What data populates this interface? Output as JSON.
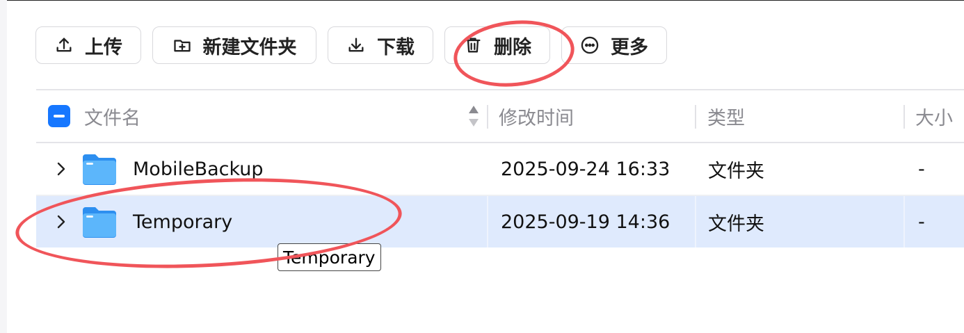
{
  "toolbar": {
    "upload": "上传",
    "new_folder": "新建文件夹",
    "download": "下载",
    "delete": "删除",
    "more": "更多"
  },
  "table": {
    "headers": {
      "name": "文件名",
      "modified": "修改时间",
      "type": "类型",
      "size": "大小"
    },
    "rows": [
      {
        "name": "MobileBackup",
        "modified": "2025-09-24 16:33",
        "type": "文件夹",
        "size": "-"
      },
      {
        "name": "Temporary",
        "modified": "2025-09-19 14:36",
        "type": "文件夹",
        "size": "-",
        "selected": true
      }
    ]
  },
  "tooltip": "Temporary",
  "colors": {
    "accent": "#1677ff",
    "selected_row": "#dfeafd",
    "annotation": "#f0555a",
    "folder": "#3aa0f5"
  },
  "icons": {
    "upload": "upload-icon",
    "new_folder": "folder-plus-icon",
    "download": "download-icon",
    "delete": "trash-icon",
    "more": "more-circle-icon",
    "row_expand": "chevron-right-icon",
    "row_type": "folder-icon"
  }
}
